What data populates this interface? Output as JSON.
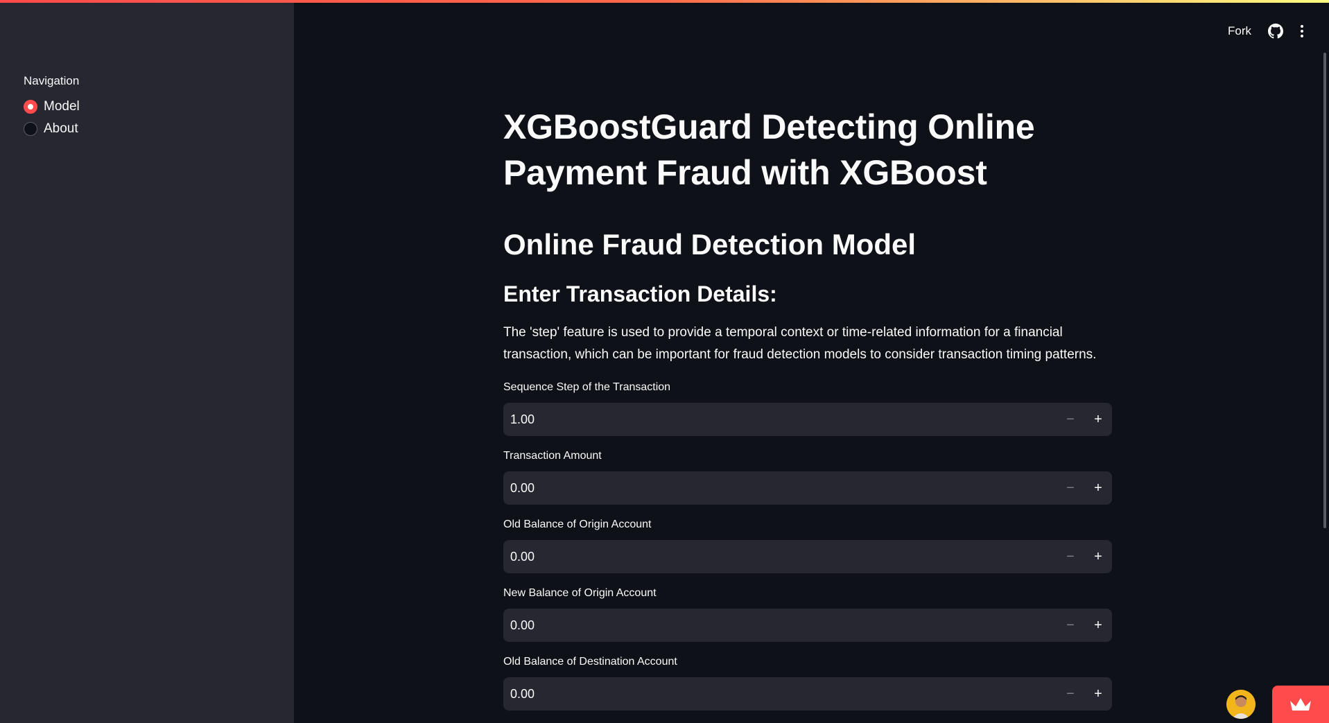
{
  "sidebar": {
    "nav_label": "Navigation",
    "options": [
      {
        "label": "Model",
        "selected": true
      },
      {
        "label": "About",
        "selected": false
      }
    ]
  },
  "header": {
    "fork_label": "Fork",
    "github_icon": "github-icon",
    "menu_icon": "kebab-menu-icon"
  },
  "main": {
    "title": "XGBoostGuard Detecting Online Payment Fraud with XGBoost",
    "subtitle": "Online Fraud Detection Model",
    "section_heading": "Enter Transaction Details:",
    "description": "The 'step' feature is used to provide a temporal context or time-related information for a financial transaction, which can be important for fraud detection models to consider transaction timing patterns.",
    "fields": [
      {
        "label": "Sequence Step of the Transaction",
        "value": "1.00"
      },
      {
        "label": "Transaction Amount",
        "value": "0.00"
      },
      {
        "label": "Old Balance of Origin Account",
        "value": "0.00"
      },
      {
        "label": "New Balance of Origin Account",
        "value": "0.00"
      },
      {
        "label": "Old Balance of Destination Account",
        "value": "0.00"
      }
    ],
    "minus_symbol": "−",
    "plus_symbol": "+"
  },
  "colors": {
    "background": "#0e1117",
    "sidebar": "#262730",
    "accent": "#ff4b4b",
    "input_bg": "#262730"
  }
}
